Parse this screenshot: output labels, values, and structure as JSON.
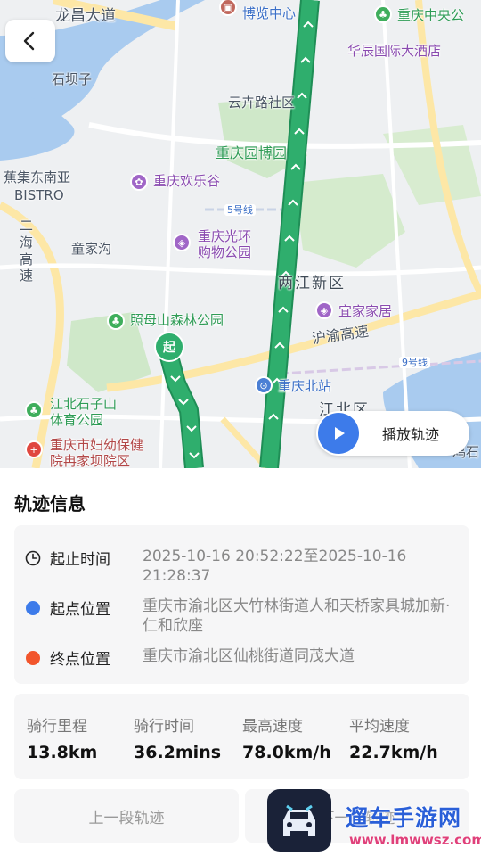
{
  "map": {
    "labels": {
      "road_top": "龙昌大道",
      "museum_center": "博览中心",
      "chongqing_central": "重庆中央公",
      "huachen_hotel": "华辰国际大酒店",
      "shibazi": "石坝子",
      "yunjinglu": "云卉路社区",
      "expo_park": "重庆园博园",
      "bistro_cn": "蕉集东南亚",
      "bistro_en": "BISTRO",
      "happy_valley": "重庆欢乐谷",
      "line5": "5号线",
      "guanghuan_1": "重庆光环",
      "guanghuan_2": "购物公园",
      "tongjiagou": "童家沟",
      "erhuan": "二海高速",
      "liangjiang": "两江新区",
      "zhaomushan": "照母山森林公园",
      "yijia": "宜家家居",
      "huyu": "沪渝高速",
      "line9": "9号线",
      "north_station": "重庆北站",
      "jiangbei_shizishan_1": "江北石子山",
      "jiangbei_shizishan_2": "体育公园",
      "jiangbeiqu": "江北区",
      "fuyou_1": "重庆市妇幼保健",
      "fuyou_2": "院冉家坝院区",
      "ekou": "鸡石"
    },
    "start_marker": "起",
    "play_button": "播放轨迹"
  },
  "panel": {
    "title": "轨迹信息",
    "time_label": "起止时间",
    "time_value": "2025-10-16 20:52:22至2025-10-16 21:28:37",
    "start_label": "起点位置",
    "start_value": "重庆市渝北区大竹林街道人和天桥家具城加新·仁和欣座",
    "end_label": "终点位置",
    "end_value": "重庆市渝北区仙桃街道同茂大道",
    "stats": [
      {
        "label": "骑行里程",
        "value": "13.8km"
      },
      {
        "label": "骑行时间",
        "value": "36.2mins"
      },
      {
        "label": "最高速度",
        "value": "78.0km/h"
      },
      {
        "label": "平均速度",
        "value": "22.7km/h"
      }
    ],
    "prev_button": "上一段轨迹",
    "next_button": "下一段轨迹"
  },
  "watermark": {
    "name": "遛车手游网",
    "url": "www.lmwwsz.com"
  },
  "colors": {
    "route": "#2fae6d",
    "accent_blue": "#3d7bea",
    "end_orange": "#f2552c"
  }
}
